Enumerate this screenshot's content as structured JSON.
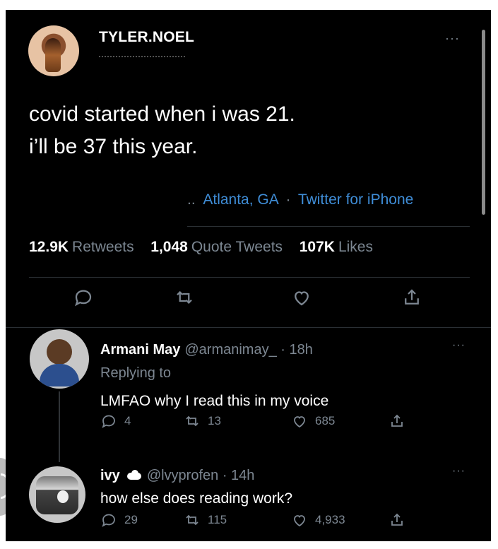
{
  "main_tweet": {
    "username": "TYLER.NOEL",
    "text_line_1": "covid started when i was 21.",
    "text_line_2": "i’ll be 37 this year.",
    "meta": {
      "prefix": "..",
      "location": "Atlanta, GA",
      "separator": "·",
      "client": "Twitter for iPhone"
    },
    "stats": {
      "retweets_count": "12.9K",
      "retweets_label": "Retweets",
      "quote_count": "1,048",
      "quote_label": "Quote Tweets",
      "likes_count": "107K",
      "likes_label": "Likes"
    }
  },
  "replies": [
    {
      "name": "Armani May",
      "handle": "@armanimay_",
      "time": "· 18h",
      "replying_to": "Replying to",
      "text": "LMFAO why I read this in my voice",
      "reply_count": "4",
      "retweet_count": "13",
      "like_count": "685"
    },
    {
      "name": "ivy",
      "handle": "@lvyprofen",
      "time": "· 14h",
      "text": "how else does reading work?",
      "reply_count": "29",
      "retweet_count": "115",
      "like_count": "4,933"
    }
  ],
  "ui": {
    "more_glyph": "···",
    "icons": [
      "reply-icon",
      "retweet-icon",
      "like-icon",
      "share-icon",
      "cloud-icon"
    ]
  }
}
